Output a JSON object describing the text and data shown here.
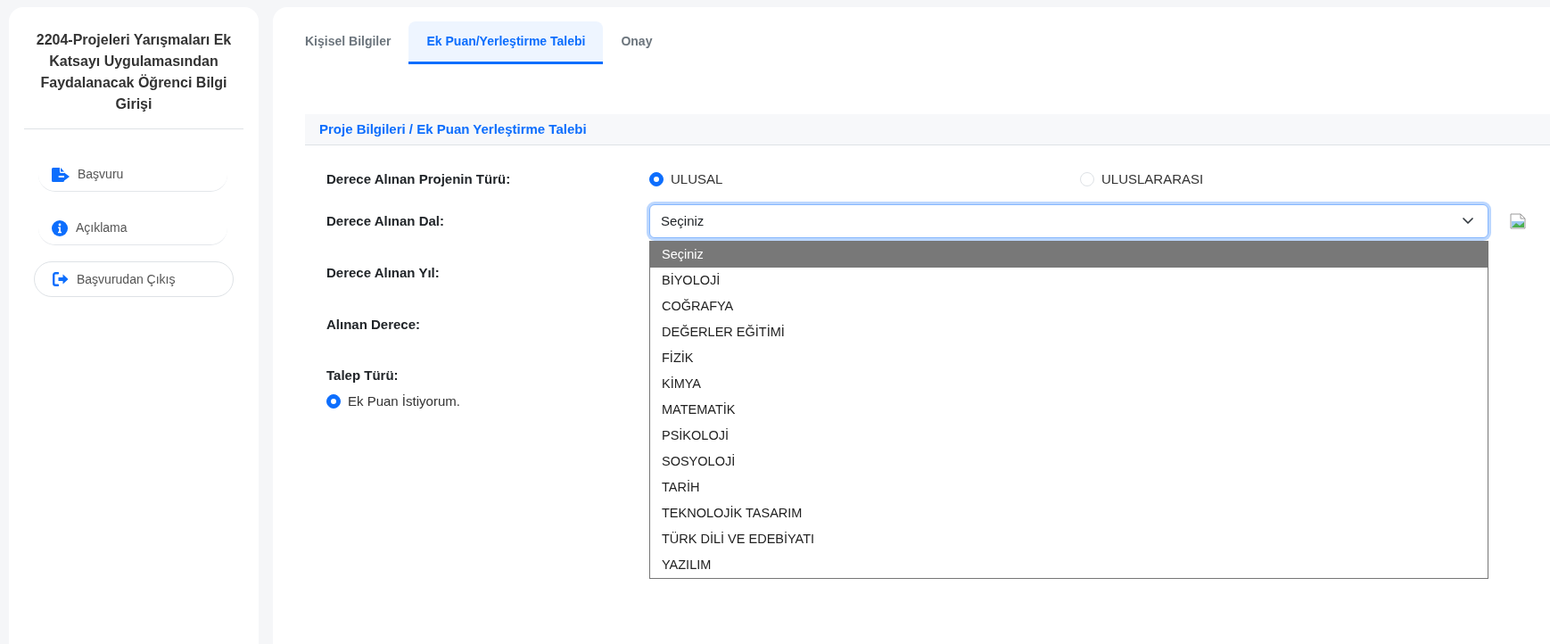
{
  "sidebar": {
    "title": "2204-Projeleri Yarışmaları Ek Katsayı Uygulamasından Faydalanacak Öğrenci Bilgi Girişi",
    "items": [
      {
        "label": "Başvuru",
        "kind": "link"
      },
      {
        "label": "Açıklama",
        "kind": "link"
      },
      {
        "label": "Başvurudan Çıkış",
        "kind": "button"
      }
    ]
  },
  "tabs": [
    {
      "label": "Kişisel Bilgiler",
      "selected": false
    },
    {
      "label": "Ek Puan/Yerleştirme Talebi",
      "selected": true
    },
    {
      "label": "Onay",
      "selected": false
    }
  ],
  "section": {
    "title": "Proje Bilgileri / Ek Puan Yerleştirme Talebi"
  },
  "form": {
    "fields": [
      {
        "label": "Derece Alınan Projenin Türü:",
        "kind": "radio",
        "options": [
          {
            "label": "ULUSAL",
            "selected": true
          },
          {
            "label": "ULUSLARARASI",
            "selected": false
          }
        ]
      },
      {
        "label": "Derece Alınan Dal:",
        "kind": "select",
        "value": "Seçiniz",
        "expanded": true,
        "options": [
          {
            "label": "Seçiniz",
            "selected": true
          },
          {
            "label": "BİYOLOJİ",
            "selected": false
          },
          {
            "label": "COĞRAFYA",
            "selected": false
          },
          {
            "label": "DEĞERLER EĞİTİMİ",
            "selected": false
          },
          {
            "label": "FİZİK",
            "selected": false
          },
          {
            "label": "KİMYA",
            "selected": false
          },
          {
            "label": "MATEMATİK",
            "selected": false
          },
          {
            "label": "PSİKOLOJİ",
            "selected": false
          },
          {
            "label": "SOSYOLOJİ",
            "selected": false
          },
          {
            "label": "TARİH",
            "selected": false
          },
          {
            "label": "TEKNOLOJİK TASARIM",
            "selected": false
          },
          {
            "label": "TÜRK DİLİ VE EDEBİYATI",
            "selected": false
          },
          {
            "label": "YAZILIM",
            "selected": false
          }
        ]
      },
      {
        "label": "Derece Alınan Yıl:",
        "kind": "label"
      },
      {
        "label": "Alınan Derece:",
        "kind": "label"
      },
      {
        "label": "Talep Türü:",
        "kind": "radiolist",
        "options": [
          {
            "label": "Ek Puan İstiyorum.",
            "selected": true
          }
        ]
      }
    ]
  }
}
